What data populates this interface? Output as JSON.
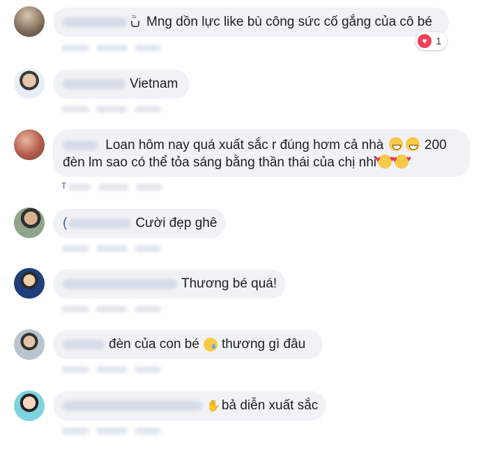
{
  "comments": [
    {
      "message": "Mng dồn lực like bù công sức cố gắng của cô bé",
      "reaction_count": "1"
    },
    {
      "message": "Vietnam"
    },
    {
      "line1": "Loan hôm nay quá xuất sắc r đúng hơm cả nhà",
      "line1_suffix": "200",
      "line2": "đèn lm sao có thể tỏa sáng bằng thần thái của chị nhỉ",
      "meta_fragment": "T"
    },
    {
      "message": "Cười đẹp ghê",
      "name_fragment": "("
    },
    {
      "message": "Thương bé quá!"
    },
    {
      "message_pre": "đèn của con bé",
      "message_post": "thương gì đâu"
    },
    {
      "message": "bả diễn xuất sắc"
    }
  ],
  "icons": {
    "coffee": "hot-beverage-icon",
    "heart_reaction": "heart-icon",
    "grin": "grinning-sweat-face-icon",
    "love": "smiling-face-with-hearts-icon",
    "sad": "sad-tear-face-icon",
    "hand": "waving-hand-icon"
  },
  "colors": {
    "bubble": "#f0f2f5",
    "heart": "#f33e58",
    "link": "#385898"
  }
}
